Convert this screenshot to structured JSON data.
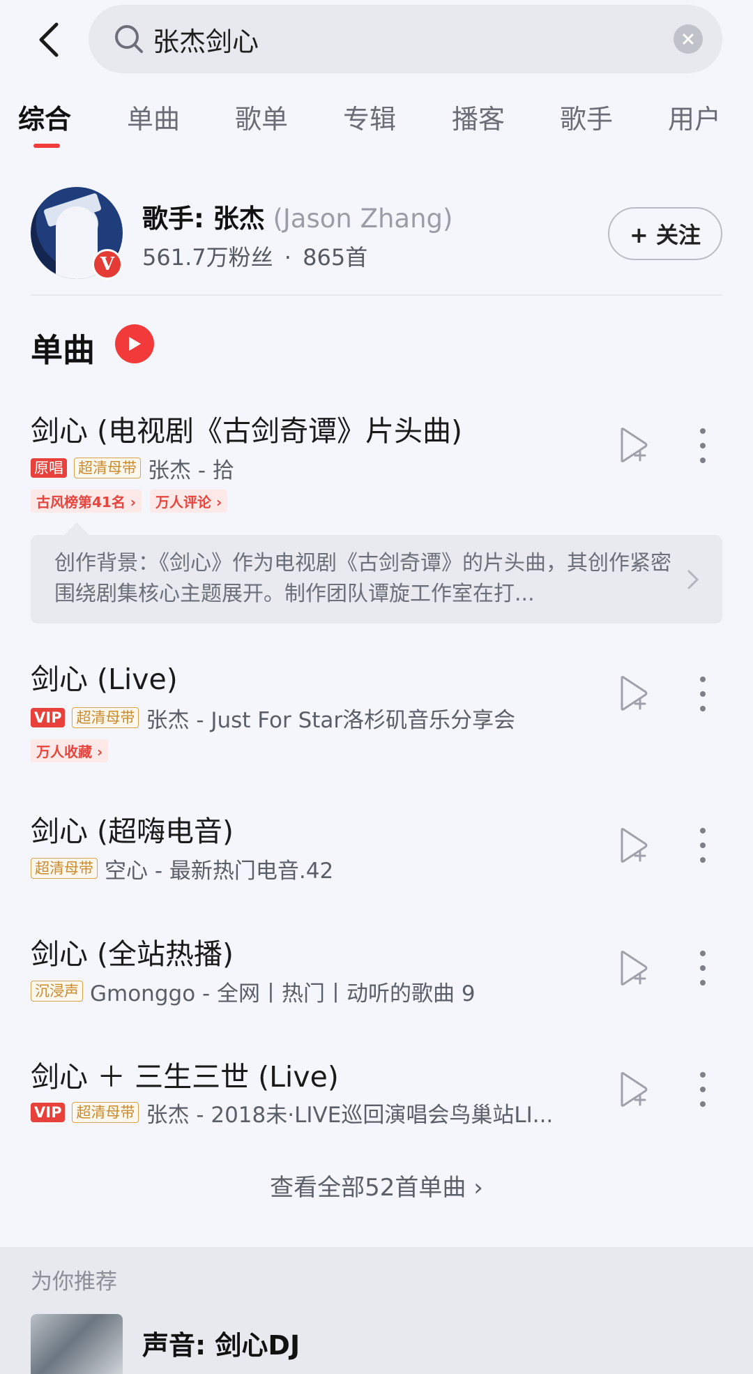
{
  "search": {
    "query": "张杰剑心"
  },
  "tabs": [
    "综合",
    "单曲",
    "歌单",
    "专辑",
    "播客",
    "歌手",
    "用户"
  ],
  "artist": {
    "prefix": "歌手: 张杰",
    "english": "(Jason Zhang)",
    "fans": "561.7万粉丝",
    "separator": "·",
    "songs": "865首",
    "follow_label": "+ 关注",
    "badge": "V"
  },
  "section": {
    "title": "单曲"
  },
  "songs": [
    {
      "title": "剑心 (电视剧《古剑奇谭》片头曲)",
      "tags": [
        "原唱",
        "超清母带"
      ],
      "meta": "张杰 - 拾",
      "ranks": [
        "古风榜第41名 ›",
        "万人评论 ›"
      ]
    },
    {
      "title": "剑心 (Live)",
      "tags": [
        "VIP",
        "超清母带"
      ],
      "meta": "张杰 - Just For Star洛杉矶音乐分享会",
      "ranks": [
        "万人收藏 ›"
      ]
    },
    {
      "title": "剑心 (超嗨电音)",
      "tags": [
        "超清母带"
      ],
      "meta": "空心 - 最新热门电音.42",
      "ranks": []
    },
    {
      "title": "剑心 (全站热播)",
      "tags": [
        "沉浸声"
      ],
      "meta": "Gmonggo - 全网丨热门丨动听的歌曲 9",
      "ranks": []
    },
    {
      "title": "剑心 ＋ 三生三世 (Live)",
      "tags": [
        "VIP",
        "超清母带"
      ],
      "meta": "张杰 - 2018未·LIVE巡回演唱会鸟巢站LI...",
      "ranks": []
    }
  ],
  "background_note": "创作背景：《剑心》作为电视剧《古剑奇谭》的片头曲，其创作紧密围绕剧集核心主题展开。制作团队谭旋工作室在打...",
  "view_all": "查看全部52首单曲 ›",
  "recommend": {
    "label": "为你推荐",
    "title": "声音: 剑心DJ"
  },
  "colors": {
    "accent": "#f23a3a",
    "gold": "#d9a24a"
  }
}
